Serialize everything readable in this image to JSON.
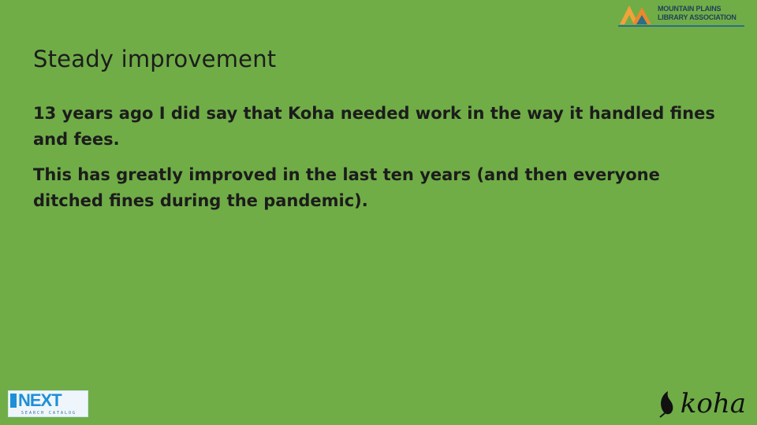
{
  "slide": {
    "title": "Steady improvement",
    "paragraphs": [
      "13 years ago I did say that Koha needed work in the way it handled fines and fees.",
      "This has greatly improved in the last ten years (and then everyone ditched fines during the pandemic)."
    ]
  },
  "logos": {
    "mpla_line1": "MOUNTAIN PLAINS",
    "mpla_line2": "LIBRARY ASSOCIATION",
    "next_word": "NEXT",
    "next_sub": "SEARCH CATALOG",
    "koha_word": "koha"
  },
  "colors": {
    "background": "#70AD47",
    "text": "#1c1c1c"
  }
}
